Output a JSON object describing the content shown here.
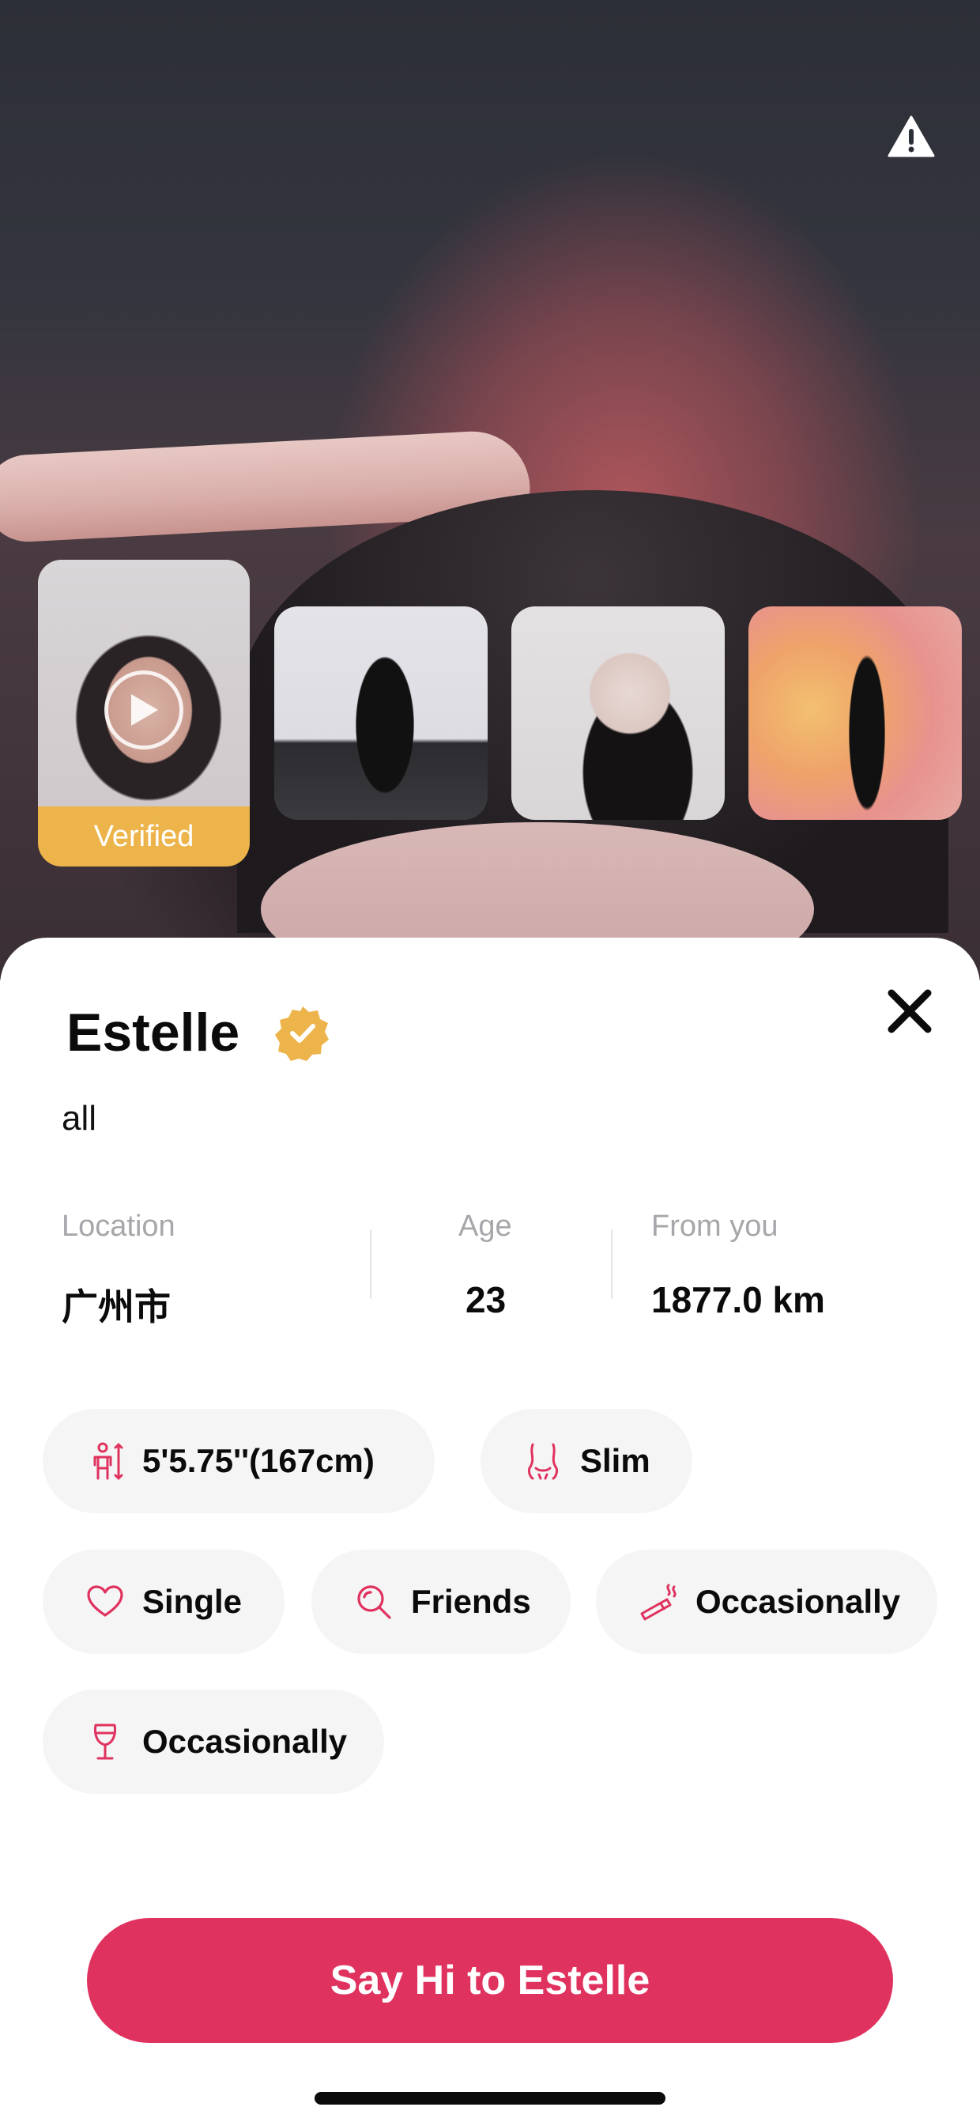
{
  "profile": {
    "name": "Estelle",
    "bio": "all",
    "verified_label": "Verified"
  },
  "stats": {
    "location_label": "Location",
    "location_value": "广州市",
    "age_label": "Age",
    "age_value": "23",
    "distance_label": "From you",
    "distance_value": "1877.0 km"
  },
  "attributes": [
    {
      "icon": "height-icon",
      "label": "5'5.75''(167cm)"
    },
    {
      "icon": "body-type-icon",
      "label": "Slim"
    },
    {
      "icon": "heart-icon",
      "label": "Single"
    },
    {
      "icon": "search-icon",
      "label": "Friends"
    },
    {
      "icon": "cigarette-icon",
      "label": "Occasionally"
    },
    {
      "icon": "wine-glass-icon",
      "label": "Occasionally"
    }
  ],
  "cta": {
    "label": "Say Hi to Estelle"
  },
  "icons": {
    "warning": "warning-icon",
    "close": "close-icon",
    "verified": "verified-badge-icon",
    "play": "play-icon"
  },
  "colors": {
    "accent": "#e0325f",
    "verified": "#ecb44a",
    "chip_background": "#f5f5f6",
    "muted_text": "#a7a7ab"
  }
}
